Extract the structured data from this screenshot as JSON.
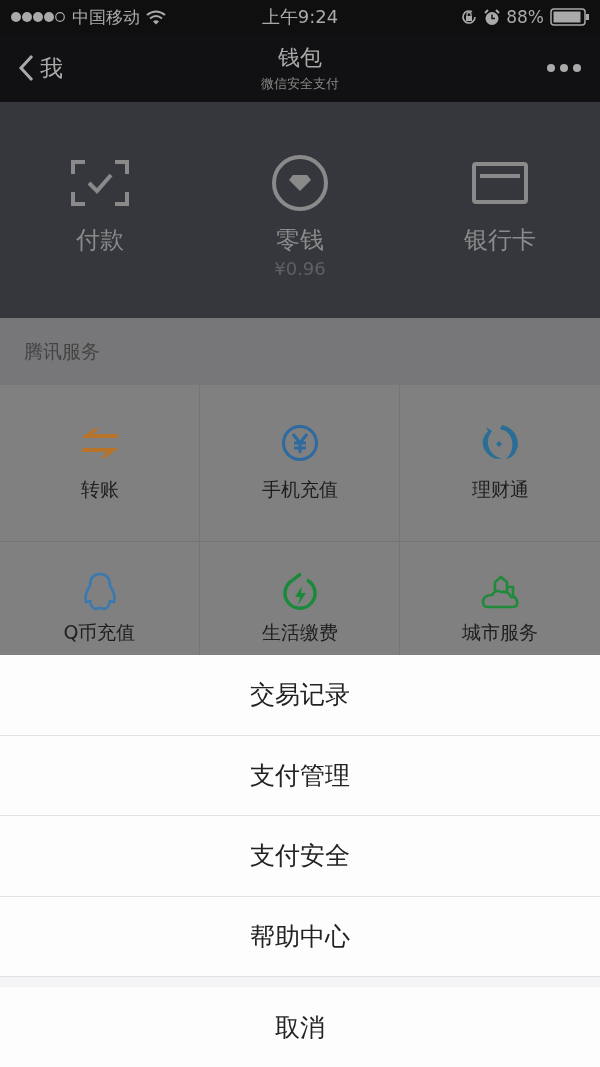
{
  "status_bar": {
    "carrier": "中国移动",
    "time": "上午9:24",
    "battery": "88%"
  },
  "nav": {
    "back": "我",
    "title": "钱包",
    "subtitle": "微信安全支付"
  },
  "wallet": [
    {
      "kind": "scan",
      "label": "付款"
    },
    {
      "kind": "coin",
      "label": "零钱",
      "amount": "¥0.96"
    },
    {
      "kind": "card",
      "label": "银行卡"
    }
  ],
  "services": {
    "title": "腾讯服务",
    "items": [
      {
        "kind": "transfer",
        "label": "转账",
        "color": "#b8732a"
      },
      {
        "kind": "yen",
        "label": "手机充值",
        "color": "#2c6aa0"
      },
      {
        "kind": "fish",
        "label": "理财通",
        "color": "#2a6e98"
      },
      {
        "kind": "penguin",
        "label": "Q币充值",
        "color": "#3a7ab0"
      },
      {
        "kind": "bolt",
        "label": "生活缴费",
        "color": "#1a8a3a"
      },
      {
        "kind": "city",
        "label": "城市服务",
        "color": "#1f8a3a"
      }
    ]
  },
  "action_sheet": {
    "items": [
      "交易记录",
      "支付管理",
      "支付安全",
      "帮助中心"
    ],
    "cancel": "取消"
  }
}
